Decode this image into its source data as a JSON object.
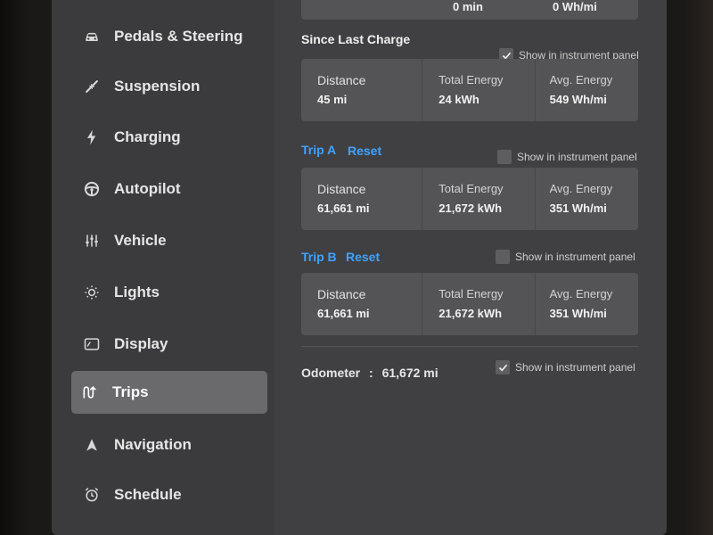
{
  "sidebar": {
    "items": [
      {
        "label": "Pedals & Steering",
        "icon": "car-icon"
      },
      {
        "label": "Suspension",
        "icon": "suspension-icon"
      },
      {
        "label": "Charging",
        "icon": "lightning-icon"
      },
      {
        "label": "Autopilot",
        "icon": "steering-wheel-icon"
      },
      {
        "label": "Vehicle",
        "icon": "sliders-icon"
      },
      {
        "label": "Lights",
        "icon": "light-icon"
      },
      {
        "label": "Display",
        "icon": "display-icon"
      },
      {
        "label": "Trips",
        "icon": "trips-icon"
      },
      {
        "label": "Navigation",
        "icon": "navigation-arrow-icon"
      },
      {
        "label": "Schedule",
        "icon": "alarm-clock-icon"
      }
    ],
    "active": "Trips"
  },
  "top_partial": {
    "left_value": "0 min",
    "right_value": "0 Wh/mi"
  },
  "since_last_charge": {
    "title": "Since Last Charge",
    "show_label": "Show in instrument panel",
    "checked": true,
    "distance_label": "Distance",
    "distance_value": "45 mi",
    "energy_label": "Total Energy",
    "energy_value": "24 kWh",
    "avg_label": "Avg. Energy",
    "avg_value": "549 Wh/mi"
  },
  "trip_a": {
    "title": "Trip A",
    "reset_label": "Reset",
    "show_label": "Show in instrument panel",
    "checked": false,
    "distance_label": "Distance",
    "distance_value": "61,661 mi",
    "energy_label": "Total Energy",
    "energy_value": "21,672 kWh",
    "avg_label": "Avg. Energy",
    "avg_value": "351 Wh/mi"
  },
  "trip_b": {
    "title": "Trip B",
    "reset_label": "Reset",
    "show_label": "Show in instrument panel",
    "checked": false,
    "distance_label": "Distance",
    "distance_value": "61,661 mi",
    "energy_label": "Total Energy",
    "energy_value": "21,672 kWh",
    "avg_label": "Avg. Energy",
    "avg_value": "351 Wh/mi"
  },
  "odometer": {
    "label": "Odometer",
    "separator": ":",
    "value": "61,672 mi",
    "show_label": "Show in instrument panel",
    "checked": true
  },
  "colors": {
    "accent": "#3ea2ff",
    "active_item": "#6a6a6c"
  }
}
